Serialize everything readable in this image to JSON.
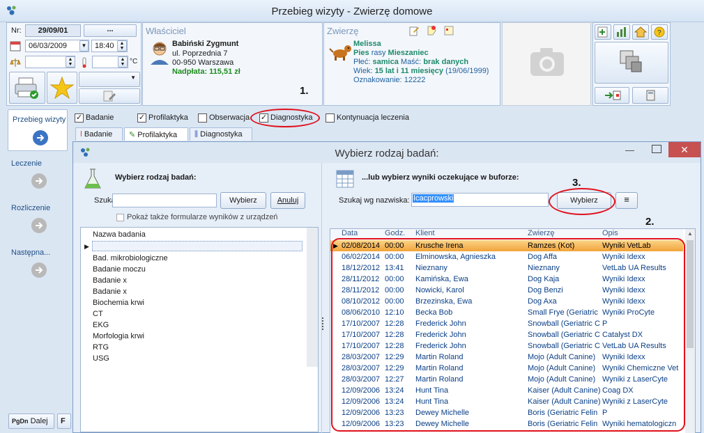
{
  "window": {
    "title": "Przebieg wizyty - Zwierzę domowe"
  },
  "visit": {
    "nr_label": "Nr:",
    "nr_value": "29/09/01",
    "nr_button": "...",
    "date": "06/03/2009",
    "time": "18:40",
    "temp_unit": "°C"
  },
  "owner": {
    "header": "Właściciel",
    "name": "Babiński Zygmunt",
    "street": "ul. Poprzednia 7",
    "city": "00-950  Warszawa",
    "balance": "Nadpłata: 115,51 zł"
  },
  "animal": {
    "header": "Zwierzę",
    "name": "Melissa",
    "species": "Pies",
    "breed_label": "rasy",
    "breed": "Mieszaniec",
    "sex_label": "Płeć:",
    "sex": "samica",
    "color_label": "Maść:",
    "color": "brak danych",
    "age_label": "Wiek:",
    "age": "15 lat i 11 miesięcy",
    "birth": "(19/06/1999)",
    "mark_label": "Oznakowanie:",
    "mark": "12222"
  },
  "nav": [
    {
      "label": "Przebieg wizyty"
    },
    {
      "label": "Leczenie"
    },
    {
      "label": "Rozliczenie"
    },
    {
      "label": "Następna..."
    }
  ],
  "bottom": {
    "key": "PgDn",
    "label": "Dalej",
    "key2": "F"
  },
  "checks": [
    {
      "label": "Badanie",
      "checked": true
    },
    {
      "label": "Profilaktyka",
      "checked": true
    },
    {
      "label": "Obserwacja",
      "checked": false
    },
    {
      "label": "Diagnostyka",
      "checked": true
    },
    {
      "label": "Kontynuacja leczenia",
      "checked": false
    }
  ],
  "tabs": [
    {
      "label": "Badanie"
    },
    {
      "label": "Profilaktyka"
    },
    {
      "label": "Diagnostyka"
    }
  ],
  "annotations": {
    "a1": "1.",
    "a2": "2.",
    "a3": "3."
  },
  "dialog": {
    "title": "Wybierz rodzaj badań:",
    "close": "✕",
    "left_header": "Wybierz rodzaj badań:",
    "search_label": "Szukaj:",
    "search_value": "",
    "choose_btn": "Wybierz",
    "cancel_btn": "Anuluj",
    "also_forms": "Pokaż także formularze wyników z urządzeń",
    "list_header": "Nazwa badania",
    "list_items": [
      "",
      "Bad. mikrobiologiczne",
      "Badanie moczu",
      "Badanie x",
      "Badanie x",
      "Biochemia krwi",
      "CT",
      "EKG",
      "Morfologia krwi",
      "RTG",
      "USG"
    ],
    "right_header": "...lub wybierz wyniki oczekujące w buforze:",
    "byname_label": "Szukaj wg nazwiska:",
    "byname_value": "Icacprowski",
    "choose_btn2": "Wybierz",
    "grid_headers": [
      "Data",
      "Godz.",
      "Klient",
      "Zwierzę",
      "Opis"
    ],
    "grid_rows": [
      [
        "02/08/2014",
        "00:00",
        "Krusche Irena",
        "Ramzes (Kot)",
        "Wyniki VetLab"
      ],
      [
        "06/02/2014",
        "00:00",
        "Elminowska, Agnieszka",
        "Dog Affa",
        "Wyniki Idexx"
      ],
      [
        "18/12/2012",
        "13:41",
        "Nieznany",
        "Nieznany",
        "VetLab UA Results"
      ],
      [
        "28/11/2012",
        "00:00",
        "Kamińska, Ewa",
        "Dog Kaja",
        "Wyniki Idexx"
      ],
      [
        "28/11/2012",
        "00:00",
        "Nowicki, Karol",
        "Dog Benzi",
        "Wyniki Idexx"
      ],
      [
        "08/10/2012",
        "00:00",
        "Brzezinska, Ewa",
        "Dog Axa",
        "Wyniki Idexx"
      ],
      [
        "08/06/2010",
        "12:10",
        "Becka Bob",
        "Small Frye (Geriatric",
        "Wyniki ProCyte"
      ],
      [
        "17/10/2007",
        "12:28",
        "Frederick John",
        "Snowball (Geriatric C",
        "P"
      ],
      [
        "17/10/2007",
        "12:28",
        "Frederick John",
        "Snowball (Geriatric C",
        "Catalyst DX"
      ],
      [
        "17/10/2007",
        "12:28",
        "Frederick John",
        "Snowball (Geriatric C",
        "VetLab UA Results"
      ],
      [
        "28/03/2007",
        "12:29",
        "Martin Roland",
        "Mojo (Adult Canine)",
        "Wyniki Idexx"
      ],
      [
        "28/03/2007",
        "12:29",
        "Martin Roland",
        "Mojo (Adult Canine)",
        "Wyniki Chemiczne Vet"
      ],
      [
        "28/03/2007",
        "12:27",
        "Martin Roland",
        "Mojo (Adult Canine)",
        "Wyniki z LaserCyte"
      ],
      [
        "12/09/2006",
        "13:24",
        "Hunt Tina",
        "Kaiser (Adult Canine)",
        "Coag DX"
      ],
      [
        "12/09/2006",
        "13:24",
        "Hunt Tina",
        "Kaiser (Adult Canine)",
        "Wyniki z LaserCyte"
      ],
      [
        "12/09/2006",
        "13:23",
        "Dewey Michelle",
        "Boris (Geriatric Felin",
        "P"
      ],
      [
        "12/09/2006",
        "13:23",
        "Dewey Michelle",
        "Boris (Geriatric Felin",
        "Wyniki hematologiczn"
      ]
    ]
  }
}
